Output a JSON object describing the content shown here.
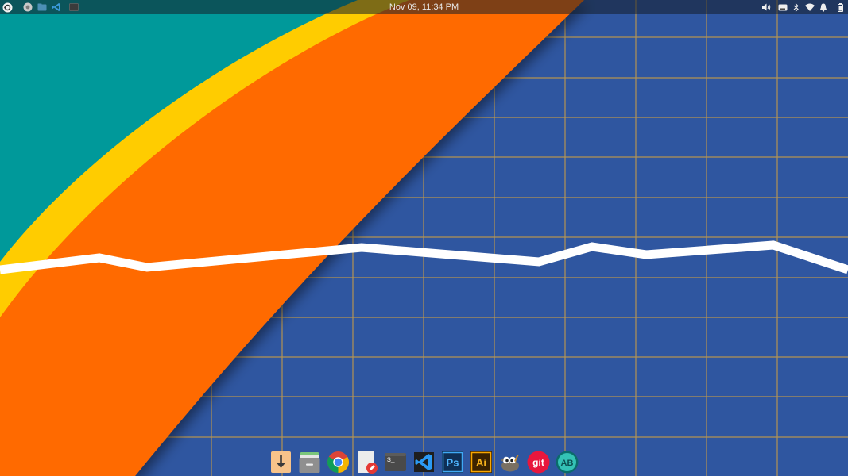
{
  "top_panel": {
    "clock": "Nov 09, 11:34 PM",
    "launchers": [
      {
        "name": "menu",
        "icon": "app-menu-icon"
      },
      {
        "name": "chrome",
        "icon": "chrome-icon"
      },
      {
        "name": "files",
        "icon": "files-icon"
      },
      {
        "name": "vscode",
        "icon": "vscode-icon"
      },
      {
        "name": "terminal",
        "icon": "terminal-icon"
      }
    ],
    "tray": [
      "volume-icon",
      "keyboard-icon",
      "bluetooth-icon",
      "wifi-icon",
      "notifications-icon",
      "battery-icon"
    ]
  },
  "dock": {
    "items": [
      {
        "name": "Downloads",
        "icon": "download-icon",
        "label": "↓"
      },
      {
        "name": "Files",
        "icon": "files-icon"
      },
      {
        "name": "Google Chrome",
        "icon": "chrome-icon"
      },
      {
        "name": "Text Editor",
        "icon": "text-editor-icon"
      },
      {
        "name": "Terminal",
        "icon": "terminal-icon",
        "label": "$_"
      },
      {
        "name": "Visual Studio Code",
        "icon": "vscode-icon"
      },
      {
        "name": "Photoshop",
        "icon": "photoshop-icon",
        "label": "Ps"
      },
      {
        "name": "Illustrator",
        "icon": "illustrator-icon",
        "label": "Ai"
      },
      {
        "name": "GIMP",
        "icon": "gimp-icon"
      },
      {
        "name": "Git",
        "icon": "git-icon",
        "label": "git"
      },
      {
        "name": "AB",
        "icon": "ab-icon",
        "label": "AB"
      }
    ]
  },
  "wallpaper": {
    "colors": {
      "teal": "#00999a",
      "yellow": "#ffcc00",
      "orange": "#ff6a00",
      "blue": "#2f56a0",
      "grid": "#c39a4a",
      "line": "#ffffff"
    }
  }
}
